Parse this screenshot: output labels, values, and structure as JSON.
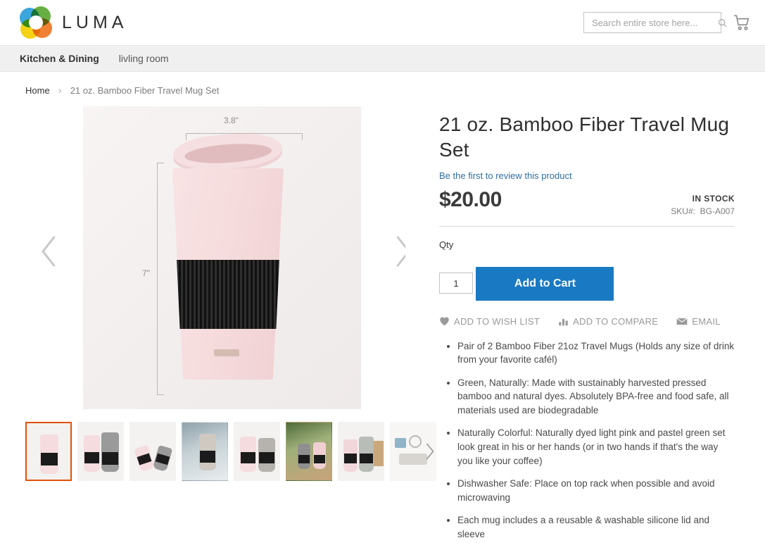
{
  "header": {
    "brand": "LUMA",
    "logo_colors": {
      "blue": "#2a9fd8",
      "green": "#5aa832",
      "orange": "#ef7622",
      "yellow": "#f3d000"
    },
    "search": {
      "placeholder": "Search entire store here...",
      "value": ""
    },
    "search_icon": "search-icon",
    "cart_icon": "cart-icon"
  },
  "topnav": {
    "items": [
      {
        "label": "Kitchen & Dining",
        "active": true
      },
      {
        "label": "livling room",
        "active": false
      }
    ]
  },
  "breadcrumb": {
    "home": "Home",
    "separator": "›",
    "current": "21 oz. Bamboo Fiber Travel Mug Set"
  },
  "gallery": {
    "prev_icon": "chevron-left-icon",
    "next_icon": "chevron-right-icon",
    "thumb_next_icon": "chevron-right-icon",
    "dimension_width": "3.8\"",
    "dimension_height": "7\"",
    "selected_thumb_index": 0,
    "selected_border_color": "#e05206",
    "thumbnails": [
      {
        "name": "mug-front-pink"
      },
      {
        "name": "mug-pair-pink-gray"
      },
      {
        "name": "mug-pair-tilted"
      },
      {
        "name": "mug-on-desk-laptop"
      },
      {
        "name": "mug-pair-lid-off"
      },
      {
        "name": "mugs-with-plants"
      },
      {
        "name": "mug-pair-with-box"
      },
      {
        "name": "product-accessories-flatlay"
      }
    ]
  },
  "product": {
    "title": "21 oz. Bamboo Fiber Travel Mug Set",
    "review_link": "Be the first to review this product",
    "price": "$20.00",
    "stock_status": "IN STOCK",
    "sku_label": "SKU#:",
    "sku_value": "BG-A007",
    "qty_label": "Qty",
    "qty_value": "1",
    "add_to_cart": "Add to Cart",
    "actions": [
      {
        "label": "ADD TO WISH LIST",
        "icon": "heart-icon"
      },
      {
        "label": "ADD TO COMPARE",
        "icon": "bar-chart-icon"
      },
      {
        "label": "EMAIL",
        "icon": "envelope-icon"
      }
    ],
    "features": [
      "Pair of 2 Bamboo Fiber 21oz Travel Mugs (Holds any size of drink from your favorite cafél)",
      "Green, Naturally: Made with sustainably harvested pressed bamboo and natural dyes. Absolutely BPA-free and food safe, all materials used are biodegradable",
      "Naturally Colorful: Naturally dyed light pink and pastel green set look great in his or her hands (or in two hands if that's the way you like your coffee)",
      "Dishwasher Safe: Place on top rack when possible and avoid microwaving",
      "Each mug includes a a reusable & washable silicone lid and sleeve"
    ]
  },
  "theme": {
    "accent": "#1979c3",
    "link": "#2f6ea6",
    "nav_bg": "#f0f0f0"
  }
}
